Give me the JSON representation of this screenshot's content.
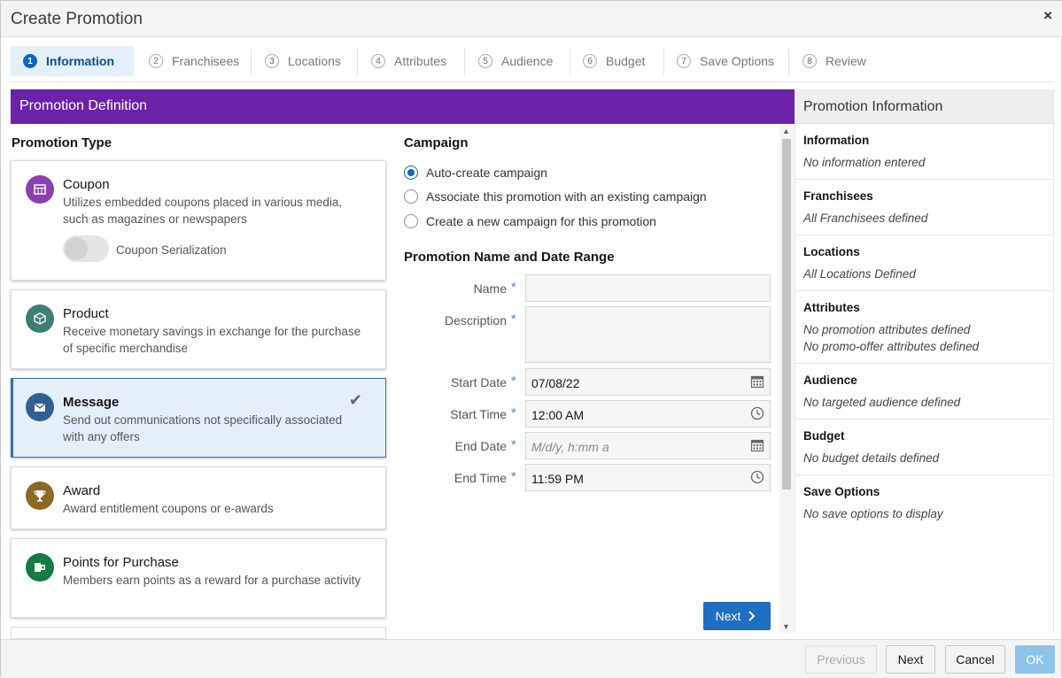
{
  "dialog": {
    "title": "Create Promotion",
    "close_glyph": "×"
  },
  "steps": [
    {
      "num": "1",
      "label": "Information"
    },
    {
      "num": "2",
      "label": "Franchisees"
    },
    {
      "num": "3",
      "label": "Locations"
    },
    {
      "num": "4",
      "label": "Attributes"
    },
    {
      "num": "5",
      "label": "Audience"
    },
    {
      "num": "6",
      "label": "Budget"
    },
    {
      "num": "7",
      "label": "Save Options"
    },
    {
      "num": "8",
      "label": "Review"
    }
  ],
  "banner": {
    "title": "Promotion Definition"
  },
  "promotion_type": {
    "title": "Promotion Type",
    "cards": [
      {
        "title": "Coupon",
        "desc": "Utilizes embedded coupons placed in various media, such as magazines or newspapers",
        "icon": "coupon-icon",
        "color": "#8a3fb0"
      },
      {
        "title": "Product",
        "desc": "Receive monetary savings in exchange for the purchase of specific merchandise",
        "icon": "box-icon",
        "color": "#3d7d74"
      },
      {
        "title": "Message",
        "desc": "Send out communications not specifically associated with any offers",
        "icon": "envelope-icon",
        "color": "#2f5f93"
      },
      {
        "title": "Award",
        "desc": "Award entitlement coupons or e-awards",
        "icon": "trophy-icon",
        "color": "#8a6a22"
      },
      {
        "title": "Points for Purchase",
        "desc": "Members earn points as a reward for a purchase activity",
        "icon": "points-icon",
        "color": "#157a45"
      }
    ],
    "toggle_label": "Coupon Serialization",
    "selected": "Message"
  },
  "campaign": {
    "title": "Campaign",
    "options": [
      {
        "label": "Auto-create campaign",
        "selected": true
      },
      {
        "label": "Associate this promotion with an existing campaign",
        "selected": false
      },
      {
        "label": "Create a new campaign for this promotion",
        "selected": false
      }
    ]
  },
  "name_date": {
    "title": "Promotion Name and Date Range",
    "required_mark": "*",
    "name_label": "Name",
    "name_value": "",
    "description_label": "Description",
    "description_value": "",
    "start_date_label": "Start Date",
    "start_date_value": "07/08/22",
    "start_time_label": "Start Time",
    "start_time_value": "12:00 AM",
    "end_date_label": "End Date",
    "end_date_placeholder": "M/d/y, h:mm a",
    "end_time_label": "End Time",
    "end_time_value": "11:59 PM"
  },
  "inline_next": {
    "label": "Next"
  },
  "info_panel": {
    "title": "Promotion Information",
    "sections": [
      {
        "heading": "Information",
        "lines": [
          "No information entered"
        ]
      },
      {
        "heading": "Franchisees",
        "lines": [
          "All Franchisees defined"
        ]
      },
      {
        "heading": "Locations",
        "lines": [
          "All Locations Defined"
        ]
      },
      {
        "heading": "Attributes",
        "lines": [
          "No promotion attributes defined",
          "No promo-offer attributes defined"
        ]
      },
      {
        "heading": "Audience",
        "lines": [
          "No targeted audience defined"
        ]
      },
      {
        "heading": "Budget",
        "lines": [
          "No budget details defined"
        ]
      },
      {
        "heading": "Save Options",
        "lines": [
          "No save options to display"
        ]
      }
    ]
  },
  "footer": {
    "previous": "Previous",
    "next": "Next",
    "cancel": "Cancel",
    "ok": "OK"
  },
  "colors": {
    "accent": "#0a67bd",
    "banner": "#6b21a8",
    "ok_disabled": "#8fc4ea"
  }
}
